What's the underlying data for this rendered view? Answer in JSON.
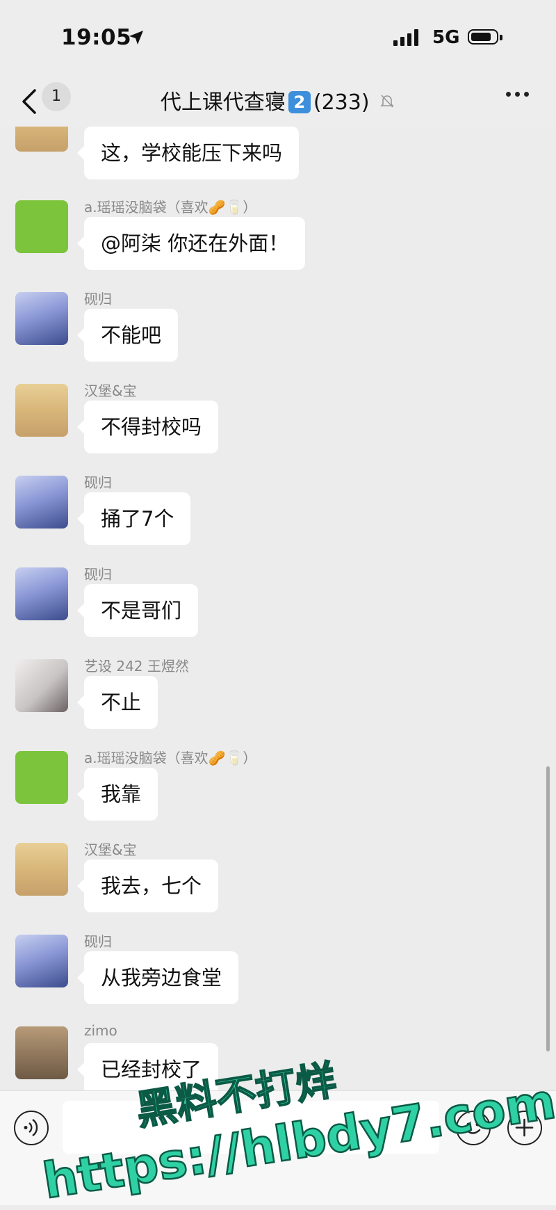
{
  "status_bar": {
    "time": "19:05",
    "network": "5G"
  },
  "nav": {
    "unread_count": "1",
    "title": "代上课代查寝",
    "badge": "2",
    "member_count": "(233)"
  },
  "messages": [
    {
      "sender": "",
      "text": "这，学校能压下来吗",
      "avatar": "baby"
    },
    {
      "sender": "a.瑶瑶没脑袋（喜欢🥜🥛）",
      "text": "@阿柒 你还在外面！",
      "avatar": "green"
    },
    {
      "sender": "砚归",
      "text": "不能吧",
      "avatar": "anime"
    },
    {
      "sender": "汉堡&宝",
      "text": "不得封校吗",
      "avatar": "baby"
    },
    {
      "sender": "砚归",
      "text": "捅了7个",
      "avatar": "anime"
    },
    {
      "sender": "砚归",
      "text": "不是哥们",
      "avatar": "anime"
    },
    {
      "sender": "艺设 242 王煜然",
      "text": "不止",
      "avatar": "gray"
    },
    {
      "sender": "a.瑶瑶没脑袋（喜欢🥜🥛）",
      "text": "我靠",
      "avatar": "green"
    },
    {
      "sender": "汉堡&宝",
      "text": "我去，七个",
      "avatar": "baby"
    },
    {
      "sender": "砚归",
      "text": "从我旁边食堂",
      "avatar": "anime"
    },
    {
      "sender": "zimo",
      "text": "已经封校了",
      "avatar": "brown"
    }
  ],
  "input": {
    "value": ""
  },
  "watermark": {
    "line1": "黑料不打烊",
    "line2": "https://hlbdy7.com"
  }
}
